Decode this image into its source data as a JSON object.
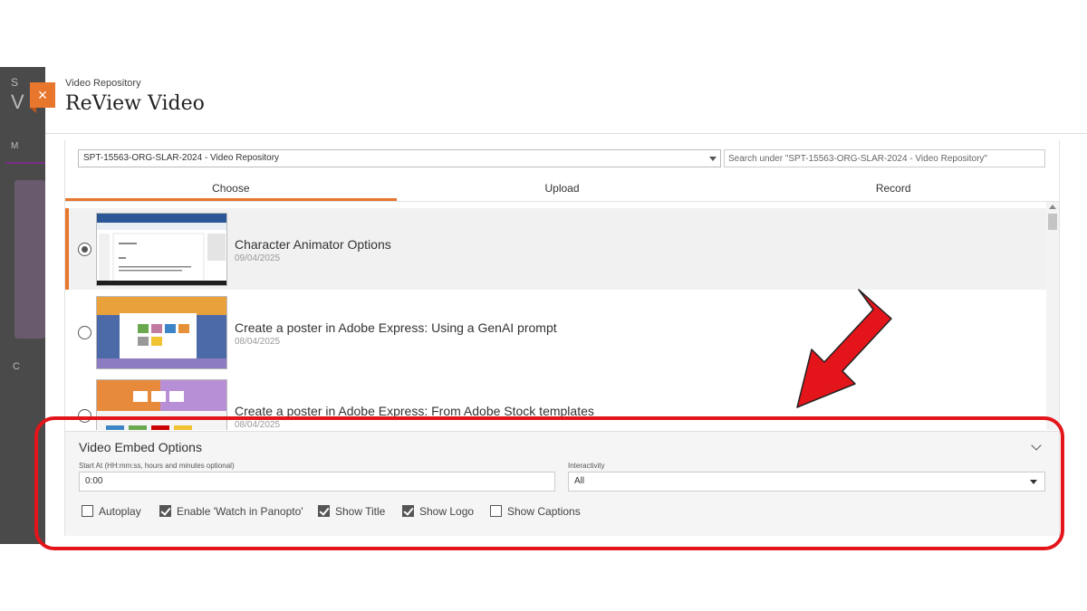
{
  "breadcrumb": "Video Repository",
  "title": "ReView Video",
  "close_icon": "×",
  "folder_select": {
    "value": "SPT-15563-ORG-SLAR-2024 - Video Repository"
  },
  "search": {
    "placeholder": "Search under \"SPT-15563-ORG-SLAR-2024 - Video Repository\""
  },
  "tabs": [
    {
      "label": "Choose",
      "active": true
    },
    {
      "label": "Upload",
      "active": false
    },
    {
      "label": "Record",
      "active": false
    }
  ],
  "videos": [
    {
      "title": "Character Animator Options",
      "date": "09/04/2025",
      "selected": true
    },
    {
      "title": "Create a poster in Adobe Express: Using a GenAI prompt",
      "date": "08/04/2025",
      "selected": false
    },
    {
      "title": "Create a poster in Adobe Express: From Adobe Stock templates",
      "date": "08/04/2025",
      "selected": false
    }
  ],
  "embed_options": {
    "title": "Video Embed Options",
    "start_at_label": "Start At (HH:mm:ss, hours and minutes optional)",
    "start_at_value": "0:00",
    "interactivity_label": "Interactivity",
    "interactivity_value": "All",
    "checkboxes": [
      {
        "label": "Autoplay",
        "checked": false
      },
      {
        "label": "Enable 'Watch in Panopto'",
        "checked": true
      },
      {
        "label": "Show Title",
        "checked": true
      },
      {
        "label": "Show Logo",
        "checked": true
      },
      {
        "label": "Show Captions",
        "checked": false
      }
    ]
  },
  "colors": {
    "accent": "#e8762d",
    "annotation": "#e3151b"
  }
}
